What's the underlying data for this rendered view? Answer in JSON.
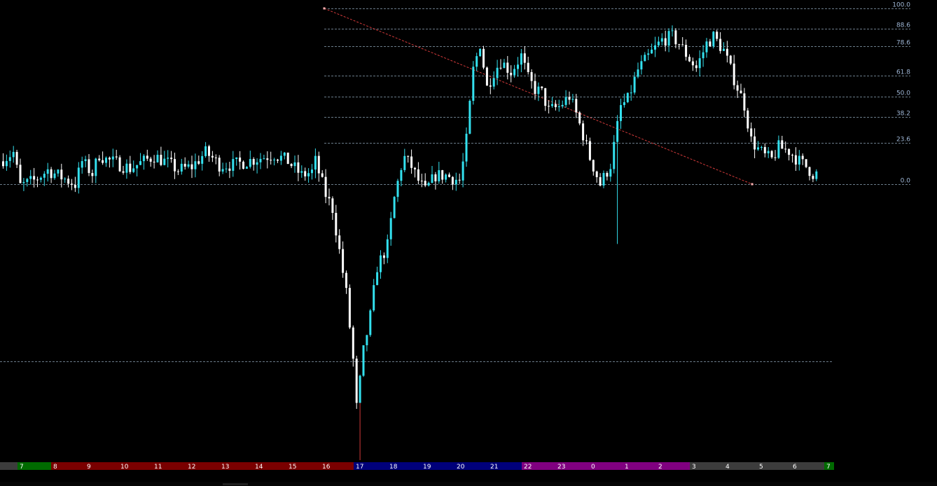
{
  "chart_data": {
    "type": "candlestick",
    "colors": {
      "up": "#33e0ee",
      "down": "#ffffff",
      "fib_line": "#8fa6b8",
      "fib_label": "#9fb7d6",
      "trendline": "#d23a3a",
      "background": "#000000"
    },
    "fib_levels": [
      {
        "label": "100.0",
        "price": 100.0
      },
      {
        "label": "88.6",
        "price": 88.6
      },
      {
        "label": "78.6",
        "price": 78.6
      },
      {
        "label": "61.8",
        "price": 61.8
      },
      {
        "label": "50.0",
        "price": 50.0
      },
      {
        "label": "38.2",
        "price": 38.2
      },
      {
        "label": "23.6",
        "price": 23.6
      },
      {
        "label": "0.0",
        "price": 0.0
      }
    ],
    "reference_line_price": -100.6,
    "trendline": {
      "start": {
        "bar": 94,
        "price": 100.0
      },
      "end": {
        "bar": 218,
        "price": 0.0
      }
    },
    "y_range": [
      -157,
      105
    ],
    "bar_count": 238,
    "anchors": [
      [
        0,
        13
      ],
      [
        4,
        18
      ],
      [
        6,
        -1
      ],
      [
        10,
        2
      ],
      [
        14,
        8
      ],
      [
        18,
        4
      ],
      [
        22,
        0
      ],
      [
        24,
        13
      ],
      [
        27,
        6
      ],
      [
        29,
        17
      ],
      [
        31,
        14
      ],
      [
        34,
        12
      ],
      [
        38,
        9
      ],
      [
        42,
        13
      ],
      [
        45,
        16
      ],
      [
        49,
        12
      ],
      [
        52,
        8
      ],
      [
        56,
        10
      ],
      [
        60,
        18
      ],
      [
        62,
        15
      ],
      [
        64,
        11
      ],
      [
        68,
        11
      ],
      [
        72,
        13
      ],
      [
        76,
        15
      ],
      [
        80,
        17
      ],
      [
        84,
        13
      ],
      [
        88,
        5
      ],
      [
        91,
        7
      ],
      [
        92,
        13
      ],
      [
        95,
        -6
      ],
      [
        97,
        -14
      ],
      [
        99,
        -38
      ],
      [
        101,
        -62
      ],
      [
        103,
        -100
      ],
      [
        104,
        -127
      ],
      [
        105,
        -112
      ],
      [
        106,
        -95
      ],
      [
        108,
        -75
      ],
      [
        110,
        -47
      ],
      [
        113,
        -35
      ],
      [
        115,
        -8
      ],
      [
        117,
        10
      ],
      [
        118,
        15
      ],
      [
        120,
        10
      ],
      [
        122,
        2
      ],
      [
        124,
        -4
      ],
      [
        127,
        5
      ],
      [
        130,
        5
      ],
      [
        134,
        2
      ],
      [
        135,
        12
      ],
      [
        136,
        25
      ],
      [
        138,
        65
      ],
      [
        140,
        80
      ],
      [
        142,
        55
      ],
      [
        144,
        64
      ],
      [
        146,
        70
      ],
      [
        149,
        64
      ],
      [
        152,
        73
      ],
      [
        154,
        60
      ],
      [
        156,
        54
      ],
      [
        158,
        52
      ],
      [
        160,
        42
      ],
      [
        163,
        44
      ],
      [
        166,
        50
      ],
      [
        168,
        40
      ],
      [
        170,
        28
      ],
      [
        172,
        15
      ],
      [
        175,
        0
      ],
      [
        178,
        11
      ],
      [
        181,
        44
      ],
      [
        183,
        48
      ],
      [
        186,
        65
      ],
      [
        190,
        75
      ],
      [
        193,
        82
      ],
      [
        196,
        84
      ],
      [
        198,
        80
      ],
      [
        200,
        74
      ],
      [
        203,
        66
      ],
      [
        206,
        80
      ],
      [
        208,
        84
      ],
      [
        211,
        76
      ],
      [
        213,
        65
      ],
      [
        215,
        55
      ],
      [
        217,
        45
      ],
      [
        219,
        25
      ],
      [
        221,
        20
      ],
      [
        223,
        16
      ],
      [
        225,
        14
      ],
      [
        227,
        21
      ],
      [
        230,
        19
      ],
      [
        233,
        13
      ],
      [
        235,
        10
      ],
      [
        237,
        6
      ]
    ],
    "time_axis": [
      {
        "label": "7",
        "color": "#006a00",
        "session": "green"
      },
      {
        "label": "8",
        "color": "#7a0000",
        "session": "red"
      },
      {
        "label": "9",
        "color": "#7a0000",
        "session": "red"
      },
      {
        "label": "10",
        "color": "#7a0000",
        "session": "red"
      },
      {
        "label": "11",
        "color": "#7a0000",
        "session": "red"
      },
      {
        "label": "12",
        "color": "#7a0000",
        "session": "red"
      },
      {
        "label": "13",
        "color": "#7a0000",
        "session": "red"
      },
      {
        "label": "14",
        "color": "#7a0000",
        "session": "red"
      },
      {
        "label": "15",
        "color": "#7a0000",
        "session": "red"
      },
      {
        "label": "16",
        "color": "#7a0000",
        "session": "red"
      },
      {
        "label": "17",
        "color": "#00007a",
        "session": "blue"
      },
      {
        "label": "18",
        "color": "#00007a",
        "session": "blue"
      },
      {
        "label": "19",
        "color": "#00007a",
        "session": "blue"
      },
      {
        "label": "20",
        "color": "#00007a",
        "session": "blue"
      },
      {
        "label": "21",
        "color": "#00007a",
        "session": "blue"
      },
      {
        "label": "22",
        "color": "#800080",
        "session": "purple"
      },
      {
        "label": "23",
        "color": "#800080",
        "session": "purple"
      },
      {
        "label": "0",
        "color": "#800080",
        "session": "purple"
      },
      {
        "label": "1",
        "color": "#800080",
        "session": "purple"
      },
      {
        "label": "2",
        "color": "#800080",
        "session": "purple"
      },
      {
        "label": "3",
        "color": "#3c3c3c",
        "session": "grey"
      },
      {
        "label": "4",
        "color": "#3c3c3c",
        "session": "grey"
      },
      {
        "label": "5",
        "color": "#3c3c3c",
        "session": "grey"
      },
      {
        "label": "6",
        "color": "#3c3c3c",
        "session": "grey"
      },
      {
        "label": "7",
        "color": "#006a00",
        "session": "green"
      }
    ],
    "axis_lead_color": "#3c3c3c"
  }
}
